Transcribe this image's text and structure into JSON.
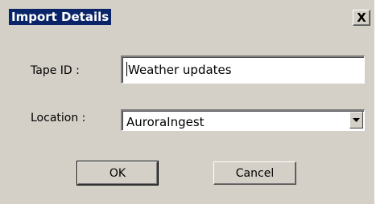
{
  "dialog": {
    "title": "Import Details",
    "close_label": "X"
  },
  "form": {
    "tape_id_label": "Tape ID :",
    "tape_id_value": "Weather updates",
    "location_label": "Location :",
    "location_value": "AuroraIngest"
  },
  "buttons": {
    "ok_label": "OK",
    "cancel_label": "Cancel"
  },
  "icons": {
    "close": "close-icon",
    "dropdown": "chevron-down-icon"
  },
  "colors": {
    "title_bar_highlight": "#0a246a",
    "dialog_background": "#d4d0c8"
  }
}
